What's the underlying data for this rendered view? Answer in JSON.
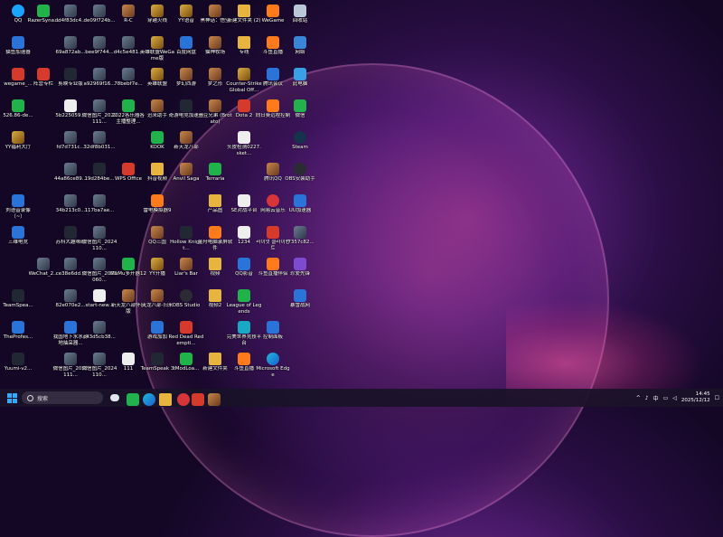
{
  "desktop_icons": [
    {
      "label": "QQ",
      "glyph": "qq",
      "col": 0,
      "row": 0,
      "color": "#1aa3ff"
    },
    {
      "label": "RazerSyna...",
      "glyph": "green",
      "col": 1,
      "row": 0
    },
    {
      "label": "dd4f83dc4...",
      "glyph": "img",
      "col": 2,
      "row": 0
    },
    {
      "label": "de09f724b...",
      "glyph": "img",
      "col": 3,
      "row": 0
    },
    {
      "label": "R-C",
      "glyph": "char",
      "col": 4,
      "row": 0
    },
    {
      "label": "穿越火线",
      "glyph": "game",
      "col": 5,
      "row": 0
    },
    {
      "label": "YY语音",
      "glyph": "game",
      "col": 6,
      "row": 0
    },
    {
      "label": "黑神话：悟空",
      "glyph": "char",
      "col": 7,
      "row": 0
    },
    {
      "label": "新建文件夹 (2)",
      "glyph": "folder",
      "col": 8,
      "row": 0
    },
    {
      "label": "WeGame",
      "glyph": "orange",
      "col": 9,
      "row": 0
    },
    {
      "label": "回收站",
      "glyph": "trash",
      "col": 10,
      "row": 0
    },
    {
      "label": "猫鱼加速器",
      "glyph": "blue",
      "col": 0,
      "row": 1
    },
    {
      "label": "69a872ab...",
      "glyph": "img",
      "col": 2,
      "row": 1
    },
    {
      "label": "bee9f744...",
      "glyph": "img",
      "col": 3,
      "row": 1
    },
    {
      "label": "d4c5e481...",
      "glyph": "img",
      "col": 4,
      "row": 1
    },
    {
      "label": "英雄联盟WeGame版",
      "glyph": "game",
      "col": 5,
      "row": 1
    },
    {
      "label": "百度网盘",
      "glyph": "blue",
      "col": 6,
      "row": 1
    },
    {
      "label": "猫神牧场",
      "glyph": "char",
      "col": 7,
      "row": 1
    },
    {
      "label": "专线",
      "glyph": "folder",
      "col": 8,
      "row": 1
    },
    {
      "label": "斗鱼直播",
      "glyph": "orange",
      "col": 9,
      "row": 1
    },
    {
      "label": "网络",
      "glyph": "net",
      "col": 10,
      "row": 1
    },
    {
      "label": "wegame_...",
      "glyph": "red",
      "col": 0,
      "row": 2
    },
    {
      "label": "阵营专栏",
      "glyph": "red",
      "col": 1,
      "row": 2
    },
    {
      "label": "剪映专业版",
      "glyph": "dark",
      "col": 2,
      "row": 2
    },
    {
      "label": "a92969f16...",
      "glyph": "img",
      "col": 3,
      "row": 2
    },
    {
      "label": "78bebf7e...",
      "glyph": "img",
      "col": 4,
      "row": 2
    },
    {
      "label": "英雄联盟",
      "glyph": "game",
      "col": 5,
      "row": 2
    },
    {
      "label": "梦幻西游",
      "glyph": "char",
      "col": 6,
      "row": 2
    },
    {
      "label": "梦之形",
      "glyph": "char",
      "col": 7,
      "row": 2
    },
    {
      "label": "Counter-Strike Global Off...",
      "glyph": "game",
      "col": 8,
      "row": 2
    },
    {
      "label": "腾讯会议",
      "glyph": "blue",
      "col": 9,
      "row": 2
    },
    {
      "label": "此电脑",
      "glyph": "pc",
      "col": 10,
      "row": 2
    },
    {
      "label": "526.86-de...",
      "glyph": "green",
      "col": 0,
      "row": 3
    },
    {
      "label": "5b225059...",
      "glyph": "file",
      "col": 2,
      "row": 3
    },
    {
      "label": "微信图片_2022111...",
      "glyph": "img",
      "col": 3,
      "row": 3
    },
    {
      "label": "2022各乐器各主播整理...",
      "glyph": "green",
      "col": 4,
      "row": 3
    },
    {
      "label": "迅米助手",
      "glyph": "char",
      "col": 5,
      "row": 3
    },
    {
      "label": "奇游电竞加速器",
      "glyph": "dark",
      "col": 6,
      "row": 3
    },
    {
      "label": "土豆兄弟 (Brotato)",
      "glyph": "char",
      "col": 7,
      "row": 3
    },
    {
      "label": "Dota 2",
      "glyph": "red",
      "col": 8,
      "row": 3
    },
    {
      "label": "向日葵远程控制",
      "glyph": "orange",
      "col": 9,
      "row": 3
    },
    {
      "label": "微信",
      "glyph": "wechat",
      "col": 10,
      "row": 3
    },
    {
      "label": "YY福利大厅",
      "glyph": "game",
      "col": 0,
      "row": 4
    },
    {
      "label": "fd7d731c...",
      "glyph": "img",
      "col": 2,
      "row": 4
    },
    {
      "label": "32df8b031...",
      "glyph": "img",
      "col": 3,
      "row": 4
    },
    {
      "label": "KOOK",
      "glyph": "green",
      "col": 5,
      "row": 4
    },
    {
      "label": "新天龙八部",
      "glyph": "char",
      "col": 6,
      "row": 4
    },
    {
      "label": "头皮检测0227.sket...",
      "glyph": "file",
      "col": 8,
      "row": 4
    },
    {
      "label": "Steam",
      "glyph": "steam",
      "col": 10,
      "row": 4
    },
    {
      "label": "44a86ce89...",
      "glyph": "img",
      "col": 2,
      "row": 5
    },
    {
      "label": "19d284be...",
      "glyph": "dark",
      "col": 3,
      "row": 5
    },
    {
      "label": "WPS Office",
      "glyph": "red",
      "col": 4,
      "row": 5
    },
    {
      "label": "抖音视频",
      "glyph": "folder",
      "col": 5,
      "row": 5
    },
    {
      "label": "Anvil Saga",
      "glyph": "char",
      "col": 6,
      "row": 5
    },
    {
      "label": "Terraria",
      "glyph": "green",
      "col": 7,
      "row": 5
    },
    {
      "label": "腾讯QQ",
      "glyph": "char",
      "col": 9,
      "row": 5
    },
    {
      "label": "OBS安装助手",
      "glyph": "obs",
      "col": 10,
      "row": 5
    },
    {
      "label": "刘语音录像（~）",
      "glyph": "blue",
      "col": 0,
      "row": 6
    },
    {
      "label": "34b213c0...",
      "glyph": "img",
      "col": 2,
      "row": 6
    },
    {
      "label": "117ba7ae...",
      "glyph": "img",
      "col": 3,
      "row": 6
    },
    {
      "label": "雷电模拟器9",
      "glyph": "orange",
      "col": 5,
      "row": 6
    },
    {
      "label": "产品图",
      "glyph": "folder",
      "col": 7,
      "row": 6
    },
    {
      "label": "SE对战平台",
      "glyph": "file",
      "col": 8,
      "row": 6
    },
    {
      "label": "网易云音乐",
      "glyph": "cloud",
      "col": 9,
      "row": 6
    },
    {
      "label": "UU加速器",
      "glyph": "blue",
      "col": 10,
      "row": 6
    },
    {
      "label": "三维电竞",
      "glyph": "blue",
      "col": 0,
      "row": 7
    },
    {
      "label": "苏科大趣味码",
      "glyph": "dark",
      "col": 2,
      "row": 7
    },
    {
      "label": "微信图片_2024110...",
      "glyph": "img",
      "col": 3,
      "row": 7
    },
    {
      "label": "QQ三国",
      "glyph": "char",
      "col": 5,
      "row": 7
    },
    {
      "label": "Hollow Knight...",
      "glyph": "dark",
      "col": 6,
      "row": 7
    },
    {
      "label": "金舟电脑录屏软件",
      "glyph": "orange",
      "col": 7,
      "row": 7
    },
    {
      "label": "1234",
      "glyph": "file",
      "col": 8,
      "row": 7
    },
    {
      "label": "라이엇 클라이언트",
      "glyph": "red",
      "col": 9,
      "row": 7
    },
    {
      "label": "f7357c82...",
      "glyph": "img",
      "col": 10,
      "row": 7
    },
    {
      "label": "WeChat_2...",
      "glyph": "img",
      "col": 1,
      "row": 8
    },
    {
      "label": "ce38e6dd...",
      "glyph": "img",
      "col": 2,
      "row": 8
    },
    {
      "label": "微信图片_2023060...",
      "glyph": "img",
      "col": 3,
      "row": 8
    },
    {
      "label": "MuMu多开器12",
      "glyph": "green",
      "col": 4,
      "row": 8
    },
    {
      "label": "YY开播",
      "glyph": "game",
      "col": 5,
      "row": 8
    },
    {
      "label": "Liar's Bar",
      "glyph": "char",
      "col": 6,
      "row": 8
    },
    {
      "label": "视频",
      "glyph": "folder",
      "col": 7,
      "row": 8
    },
    {
      "label": "QQ影音",
      "glyph": "blue",
      "col": 8,
      "row": 8
    },
    {
      "label": "斗鱼直播伴侣",
      "glyph": "orange",
      "col": 9,
      "row": 8
    },
    {
      "label": "珍爱先锋",
      "glyph": "purple",
      "col": 10,
      "row": 8
    },
    {
      "label": "TeamSpea...",
      "glyph": "dark",
      "col": 0,
      "row": 9
    },
    {
      "label": "82e070e2...",
      "glyph": "img",
      "col": 2,
      "row": 9
    },
    {
      "label": "start-new...",
      "glyph": "file",
      "col": 3,
      "row": 9
    },
    {
      "label": "新天龙八部怀旧版",
      "glyph": "char",
      "col": 4,
      "row": 9
    },
    {
      "label": "天龙八部·归来",
      "glyph": "char",
      "col": 5,
      "row": 9
    },
    {
      "label": "OBS Studio",
      "glyph": "obs",
      "col": 6,
      "row": 9
    },
    {
      "label": "视频2",
      "glyph": "folder",
      "col": 7,
      "row": 9
    },
    {
      "label": "League of Legends",
      "glyph": "green",
      "col": 8,
      "row": 9
    },
    {
      "label": "暴雪战网",
      "glyph": "blue",
      "col": 10,
      "row": 9
    },
    {
      "label": "TheProfes...",
      "glyph": "blue",
      "col": 0,
      "row": 10
    },
    {
      "label": "我国地下水水源地抽采器...",
      "glyph": "blue",
      "col": 2,
      "row": 10
    },
    {
      "label": "c43d5cb38...",
      "glyph": "img",
      "col": 3,
      "row": 10
    },
    {
      "label": "游戏加加",
      "glyph": "blue",
      "col": 5,
      "row": 10
    },
    {
      "label": "Red Dead Redempti...",
      "glyph": "red",
      "col": 6,
      "row": 10
    },
    {
      "label": "完美世界竞技平台",
      "glyph": "cyan",
      "col": 8,
      "row": 10
    },
    {
      "label": "控制面板",
      "glyph": "blue",
      "col": 9,
      "row": 10
    },
    {
      "label": "Yuumi-v2...",
      "glyph": "dark",
      "col": 0,
      "row": 11
    },
    {
      "label": "微信图片_2022111...",
      "glyph": "img",
      "col": 2,
      "row": 11
    },
    {
      "label": "微信图片_2024110...",
      "glyph": "img",
      "col": 3,
      "row": 11
    },
    {
      "label": "111",
      "glyph": "file",
      "col": 4,
      "row": 11
    },
    {
      "label": "TeamSpeak 3",
      "glyph": "dark",
      "col": 5,
      "row": 11
    },
    {
      "label": "tModLoa...",
      "glyph": "green",
      "col": 6,
      "row": 11
    },
    {
      "label": "新建文件夹",
      "glyph": "folder",
      "col": 7,
      "row": 11
    },
    {
      "label": "斗鱼直播",
      "glyph": "orange",
      "col": 8,
      "row": 11
    },
    {
      "label": "Microsoft Edge",
      "glyph": "edge",
      "col": 9,
      "row": 11
    }
  ],
  "taskbar": {
    "search_label": "搜索",
    "input_method": "中",
    "time": "14:45",
    "date": "2025/12/12"
  }
}
